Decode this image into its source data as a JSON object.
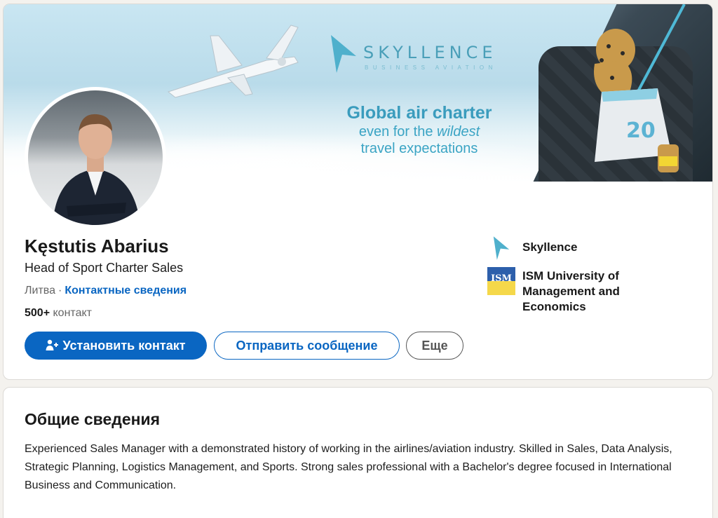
{
  "banner": {
    "brand_name": "SKYLLENCE",
    "brand_sub": "BUSINESS AVIATION",
    "slogan_line1": "Global air charter",
    "slogan_line2_prefix": "even for the ",
    "slogan_line2_emph": "wildest",
    "slogan_line3": "travel expectations",
    "jersey_number": "20"
  },
  "profile": {
    "name": "Kęstutis Abarius",
    "headline": "Head of Sport Charter Sales",
    "location": "Литва",
    "separator": "·",
    "contact_info_link": "Контактные сведения",
    "connections_count": "500+",
    "connections_label": "контакт"
  },
  "actions": {
    "connect_label": "Установить контакт",
    "message_label": "Отправить сообщение",
    "more_label": "Еще"
  },
  "companies": [
    {
      "name": "Skyllence",
      "logo": "skyllence-logo-icon"
    },
    {
      "name": "ISM University of Management and Economics",
      "logo_text": "ISM"
    }
  ],
  "about": {
    "title": "Общие сведения",
    "text": "Experienced Sales Manager with a demonstrated history of working in the airlines/aviation industry. Skilled in Sales, Data Analysis, Strategic Planning, Logistics Management, and Sports. Strong sales professional with a Bachelor's degree focused in International Business and Communication."
  },
  "colors": {
    "primary": "#0a66c2",
    "brand_teal": "#3a9cbd"
  }
}
